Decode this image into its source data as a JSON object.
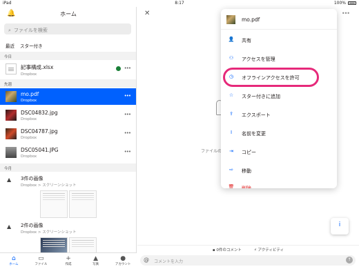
{
  "status": {
    "device": "iPad",
    "time": "8:17",
    "battery": "100%"
  },
  "left": {
    "title": "ホーム",
    "search_placeholder": "ファイルを検索",
    "filters": [
      "最近",
      "スター付き"
    ],
    "sections": {
      "today": "今日",
      "earlier": "先週",
      "this_month": "今月"
    },
    "files": [
      {
        "name": "記事構成.xlsx",
        "sub": "Dropbox"
      },
      {
        "name": "mo.pdf",
        "sub": "Dropbox"
      },
      {
        "name": "DSC04832.jpg",
        "sub": "Dropbox"
      },
      {
        "name": "DSC04787.jpg",
        "sub": "Dropbox"
      },
      {
        "name": "DSC05041.JPG",
        "sub": "Dropbox"
      }
    ],
    "groups": [
      {
        "title": "3件の画像",
        "sub": "Dropbox > スクリーンショット"
      },
      {
        "title": "2件の画像",
        "sub": "Dropbox > スクリーンショット"
      }
    ]
  },
  "tabs": [
    {
      "label": "ホーム",
      "icon": "home-icon"
    },
    {
      "label": "ファイル",
      "icon": "folder-icon"
    },
    {
      "label": "作成",
      "icon": "plus-icon"
    },
    {
      "label": "写真",
      "icon": "photo-icon"
    },
    {
      "label": "アカウント",
      "icon": "person-icon"
    }
  ],
  "right": {
    "center_text": "ファイルの",
    "comments": "0件のコメント",
    "activity": "アクティビティ",
    "comment_placeholder": "コメントを入力"
  },
  "menu": {
    "file_name": "mo.pdf",
    "items": [
      {
        "label": "共有",
        "icon": "share-person-icon"
      },
      {
        "label": "アクセスを管理",
        "icon": "manage-access-icon"
      },
      {
        "label": "オフラインアクセスを許可",
        "icon": "offline-clock-icon"
      },
      {
        "label": "スター付きに追加",
        "icon": "star-icon"
      },
      {
        "label": "エクスポート",
        "icon": "export-icon"
      },
      {
        "label": "名前を変更",
        "icon": "rename-icon"
      },
      {
        "label": "コピー",
        "icon": "copy-icon"
      },
      {
        "label": "移動",
        "icon": "move-icon"
      },
      {
        "label": "削除",
        "icon": "trash-icon"
      }
    ]
  },
  "colors": {
    "accent": "#0061fe",
    "highlight": "#e6297a",
    "danger": "#e02020"
  }
}
